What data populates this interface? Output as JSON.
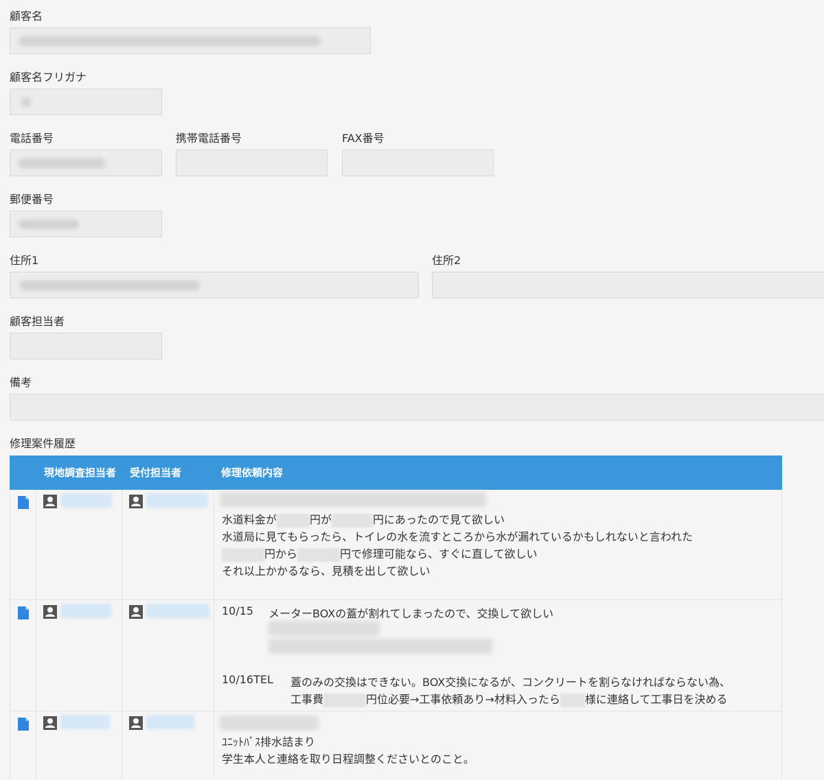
{
  "form": {
    "customer_name_label": "顧客名",
    "customer_kana_label": "顧客名フリガナ",
    "phone_label": "電話番号",
    "mobile_label": "携帯電話番号",
    "fax_label": "FAX番号",
    "postal_label": "郵便番号",
    "address1_label": "住所1",
    "address2_label": "住所2",
    "contact_label": "顧客担当者",
    "notes_label": "備考"
  },
  "history": {
    "section_label": "修理案件履歴",
    "columns": [
      "",
      "現地調査担当者",
      "受付担当者",
      "修理依頼内容"
    ],
    "rows": [
      {
        "lines": {
          "l1a": "水道料金が",
          "l1b": "円が",
          "l1c": "円にあったので見て欲しい",
          "l2": "水道局に見てもらったら、トイレの水を流すところから水が漏れているかもしれないと言われた",
          "l3a": "円から",
          "l3b": "円で修理可能なら、すぐに直して欲しい",
          "l4": "それ以上かかるなら、見積を出して欲しい"
        }
      },
      {
        "lines": {
          "date1": "10/15",
          "text1": "メーターBOXの蓋が割れてしまったので、交換して欲しい",
          "date2": "10/16TEL",
          "text2": "蓋のみの交換はできない。BOX交換になるが、コンクリートを割らなければならない為、",
          "text3a": "工事費",
          "text3b": "円位必要→工事依頼あり→材料入ったら",
          "text3c": "様に連絡して工事日を決める"
        }
      },
      {
        "lines": {
          "l1": "ﾕﾆｯﾄﾊﾞｽ排水詰まり",
          "l2": "学生本人と連絡を取り日程調整くださいとのこと。"
        }
      }
    ]
  },
  "colors": {
    "header_bg": "#3a98da",
    "doc_icon": "#2e86de"
  }
}
